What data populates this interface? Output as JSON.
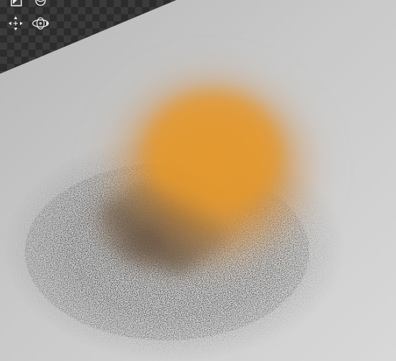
{
  "viewport": {
    "background_pattern": "checkerboard",
    "checker_colors": [
      "#2a2a2a",
      "#3a3a3a"
    ],
    "surface_color": "#c7c7c7",
    "object_color": "#e0962e",
    "shadow_color": "#3c3c3c"
  },
  "toolbar": {
    "tools": [
      {
        "name": "frame-object",
        "icon": "frame-icon"
      },
      {
        "name": "light-direction",
        "icon": "light-icon"
      },
      {
        "name": "pan-view",
        "icon": "pan-icon"
      },
      {
        "name": "orbit-view",
        "icon": "orbit-icon"
      }
    ]
  }
}
